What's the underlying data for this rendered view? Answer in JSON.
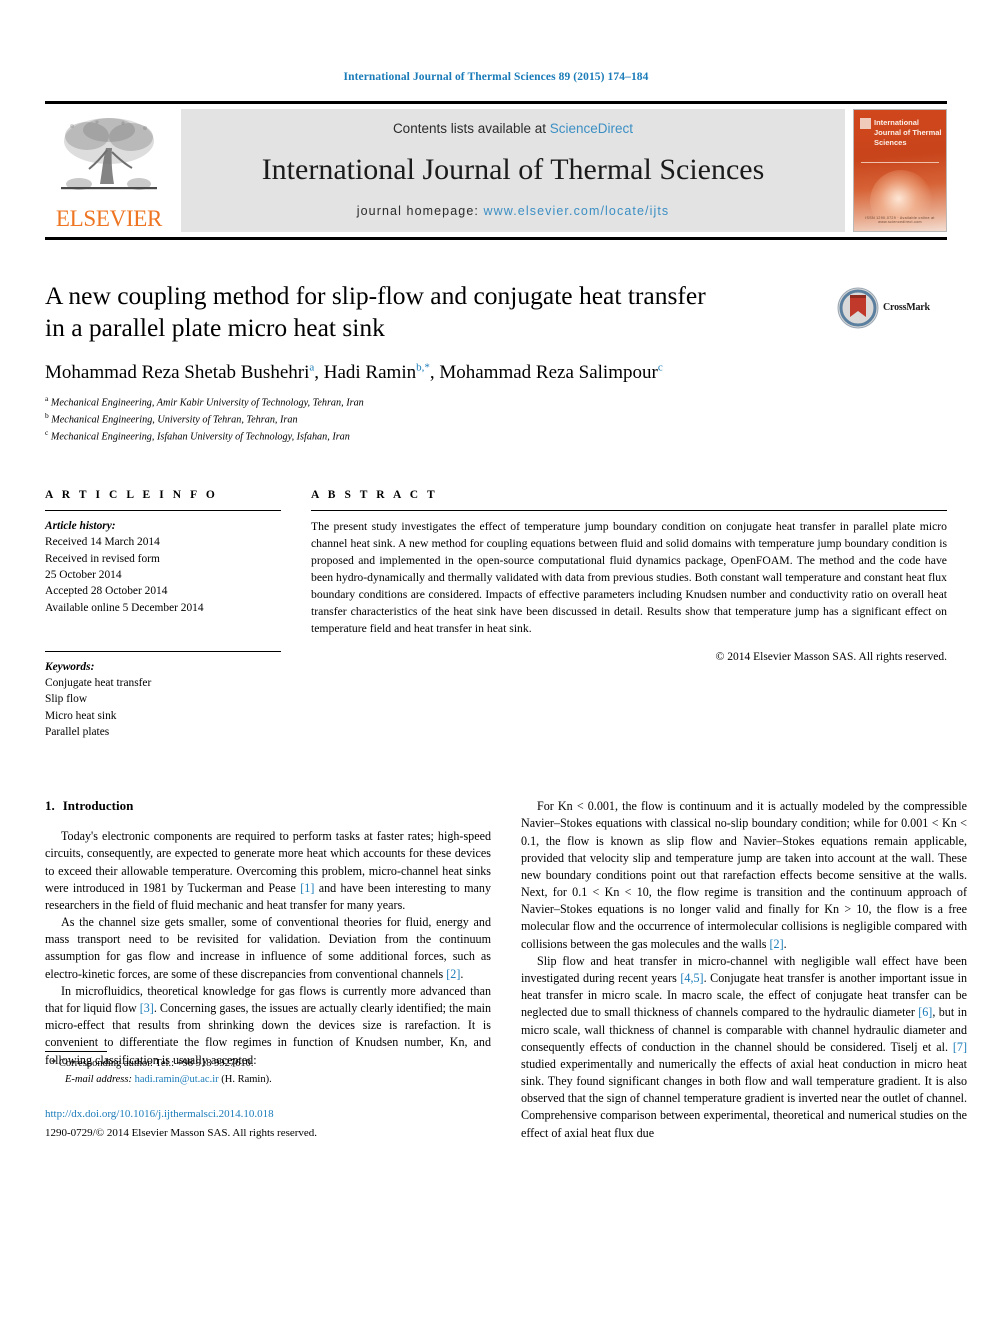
{
  "running_head": "International Journal of Thermal Sciences 89 (2015) 174–184",
  "masthead": {
    "contents_prefix": "Contents lists available at ",
    "sciencedirect": "ScienceDirect",
    "journal_title": "International Journal of Thermal Sciences",
    "homepage_prefix": "journal homepage: ",
    "homepage_url": "www.elsevier.com/locate/ijts",
    "publisher_wordmark": "ELSEVIER",
    "cover_title": "International Journal of Thermal Sciences",
    "cover_footer": "ISSN 1290-0729 · Available online at www.sciencedirect.com",
    "accent_link_color": "#3c8fc4",
    "elsevier_orange": "#ee7623",
    "cover_red": "#c8441b"
  },
  "article": {
    "title_line1": "A new coupling method for slip-flow and conjugate heat transfer",
    "title_line2": "in a parallel plate micro heat sink",
    "authors": [
      {
        "name": "Mohammad Reza Shetab Bushehri",
        "marks": "a",
        "star": false
      },
      {
        "name": "Hadi Ramin",
        "marks": "b",
        "star": true
      },
      {
        "name": "Mohammad Reza Salimpour",
        "marks": "c",
        "star": false
      }
    ],
    "affiliations": [
      {
        "mark": "a",
        "text": "Mechanical Engineering, Amir Kabir University of Technology, Tehran, Iran"
      },
      {
        "mark": "b",
        "text": "Mechanical Engineering, University of Tehran, Tehran, Iran"
      },
      {
        "mark": "c",
        "text": "Mechanical Engineering, Isfahan University of Technology, Isfahan, Iran"
      }
    ],
    "crossmark_label": "CrossMark"
  },
  "article_info": {
    "heading": "A R T I C L E   I N F O",
    "history_label": "Article history:",
    "history": [
      "Received 14 March 2014",
      "Received in revised form",
      "25 October 2014",
      "Accepted 28 October 2014",
      "Available online 5 December 2014"
    ],
    "keywords_label": "Keywords:",
    "keywords": [
      "Conjugate heat transfer",
      "Slip flow",
      "Micro heat sink",
      "Parallel plates"
    ]
  },
  "abstract": {
    "heading": "A B S T R A C T",
    "text": "The present study investigates the effect of temperature jump boundary condition on conjugate heat transfer in parallel plate micro channel heat sink. A new method for coupling equations between fluid and solid domains with temperature jump boundary condition is proposed and implemented in the open-source computational fluid dynamics package, OpenFOAM. The method and the code have been hydro-dynamically and thermally validated with data from previous studies. Both constant wall temperature and constant heat flux boundary conditions are considered. Impacts of effective parameters including Knudsen number and conductivity ratio on overall heat transfer characteristics of the heat sink have been discussed in detail. Results show that temperature jump has a significant effect on temperature field and heat transfer in heat sink.",
    "copyright": "© 2014 Elsevier Masson SAS. All rights reserved."
  },
  "body": {
    "section_number": "1.",
    "section_title": "Introduction",
    "left_paragraphs": [
      {
        "segments": [
          {
            "t": "Today's electronic components are required to perform tasks at faster rates; high-speed circuits, consequently, are expected to generate more heat which accounts for these devices to exceed their allowable temperature. Overcoming this problem, micro-channel heat sinks were introduced in 1981 by Tuckerman and Pease "
          },
          {
            "t": "[1]",
            "ref": true
          },
          {
            "t": " and have been interesting to many researchers in the field of fluid mechanic and heat transfer for many years."
          }
        ]
      },
      {
        "segments": [
          {
            "t": "As the channel size gets smaller, some of conventional theories for fluid, energy and mass transport need to be revisited for validation. Deviation from the continuum assumption for gas flow and increase in influence of some additional forces, such as electro-kinetic forces, are some of these discrepancies from conventional channels "
          },
          {
            "t": "[2]",
            "ref": true
          },
          {
            "t": "."
          }
        ]
      },
      {
        "segments": [
          {
            "t": "In microfluidics, theoretical knowledge for gas flows is currently more advanced than that for liquid flow "
          },
          {
            "t": "[3]",
            "ref": true
          },
          {
            "t": ". Concerning gases, the issues are actually clearly identified; the main micro-effect that results from shrinking down the devices size is rarefaction. It is convenient to differentiate the flow regimes in function of Knudsen number, Kn, and following classification is usually accepted:"
          }
        ]
      }
    ],
    "right_paragraphs": [
      {
        "segments": [
          {
            "t": "For Kn < 0.001, the flow is continuum and it is actually modeled by the compressible Navier–Stokes equations with classical no-slip boundary condition; while for 0.001 < Kn < 0.1, the flow is known as slip flow and Navier–Stokes equations remain applicable, provided that velocity slip and temperature jump are taken into account at the wall. These new boundary conditions point out that rarefaction effects become sensitive at the walls. Next, for 0.1 < Kn < 10, the flow regime is transition and the continuum approach of Navier–Stokes equations is no longer valid and finally for Kn > 10, the flow is a free molecular flow and the occurrence of intermolecular collisions is negligible compared with collisions between the gas molecules and the walls "
          },
          {
            "t": "[2]",
            "ref": true
          },
          {
            "t": "."
          }
        ]
      },
      {
        "segments": [
          {
            "t": "Slip flow and heat transfer in micro-channel with negligible wall effect have been investigated during recent years "
          },
          {
            "t": "[4,5]",
            "ref": true
          },
          {
            "t": ". Conjugate heat transfer is another important issue in heat transfer in micro scale. In macro scale, the effect of conjugate heat transfer can be neglected due to small thickness of channels compared to the hydraulic diameter "
          },
          {
            "t": "[6]",
            "ref": true
          },
          {
            "t": ", but in micro scale, wall thickness of channel is comparable with channel hydraulic diameter and consequently effects of conduction in the channel should be considered. Tiselj et al. "
          },
          {
            "t": "[7]",
            "ref": true
          },
          {
            "t": " studied experimentally and numerically the effects of axial heat conduction in micro heat sink. They found significant changes in both flow and wall temperature gradient. It is also observed that the sign of channel temperature gradient is inverted near the outlet of channel. Comprehensive comparison between experimental, theoretical and numerical studies on the effect of axial heat flux due"
          }
        ]
      }
    ]
  },
  "footnotes": {
    "corresponding_marker": "*",
    "corresponding": "Corresponding author. Tel.: +98 918 9927610.",
    "email_label": "E-mail address:",
    "email": "hadi.ramin@ut.ac.ir",
    "email_owner": "(H. Ramin).",
    "doi_url": "http://dx.doi.org/10.1016/j.ijthermalsci.2014.10.018",
    "issn_line": "1290-0729/© 2014 Elsevier Masson SAS. All rights reserved."
  }
}
